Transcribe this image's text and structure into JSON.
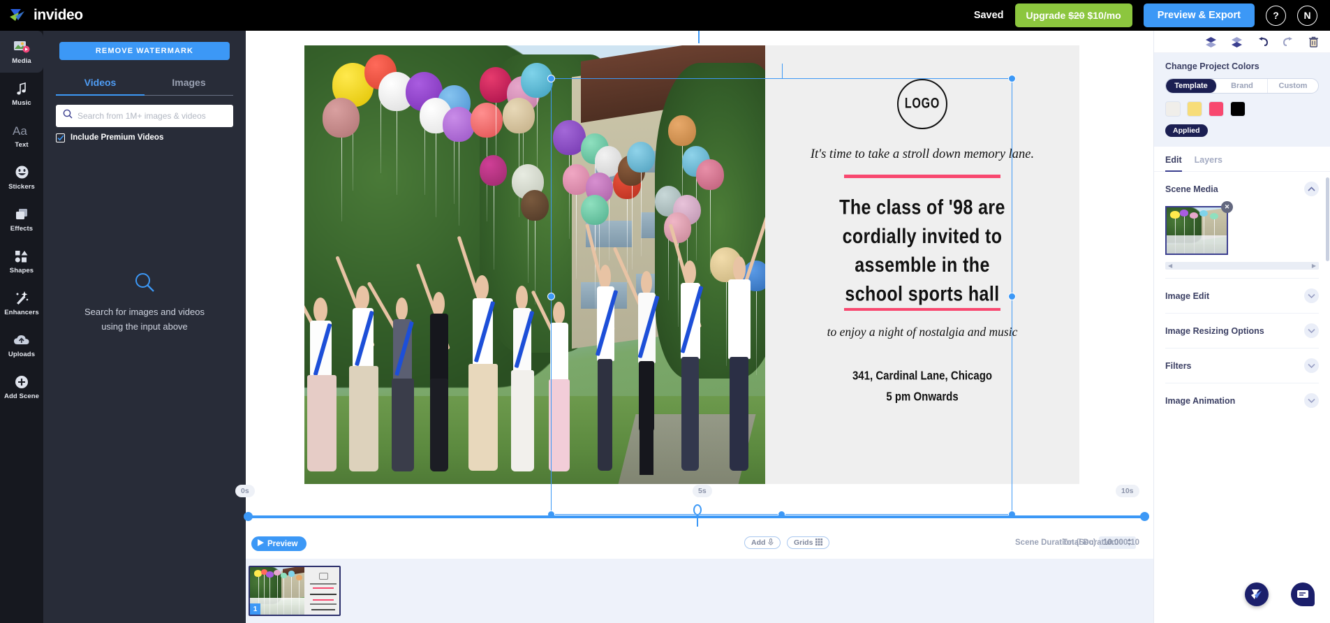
{
  "topbar": {
    "brand": "invideo",
    "saved_label": "Saved",
    "upgrade_old_price": "$20",
    "upgrade_new_price": "$10/mo",
    "upgrade_prefix": "Upgrade",
    "preview_export_label": "Preview & Export",
    "help_label": "?",
    "avatar_label": "N"
  },
  "rail": {
    "items": [
      {
        "label": "Media",
        "icon": "media-icon"
      },
      {
        "label": "Music",
        "icon": "music-note-icon"
      },
      {
        "label": "Text",
        "icon": "text-aa-icon"
      },
      {
        "label": "Stickers",
        "icon": "smiley-icon"
      },
      {
        "label": "Effects",
        "icon": "layers-squares-icon"
      },
      {
        "label": "Shapes",
        "icon": "shapes-icon"
      },
      {
        "label": "Enhancers",
        "icon": "magic-wand-icon"
      },
      {
        "label": "Uploads",
        "icon": "cloud-upload-icon"
      },
      {
        "label": "Add Scene",
        "icon": "plus-circle-icon"
      }
    ],
    "active_index": 0
  },
  "media_panel": {
    "remove_watermark_label": "REMOVE WATERMARK",
    "tabs": [
      {
        "label": "Videos",
        "active": true
      },
      {
        "label": "Images",
        "active": false
      }
    ],
    "search": {
      "value": "",
      "placeholder": "Search from 1M+ images & videos",
      "icon": "search-icon"
    },
    "premium_checkbox": {
      "label": "Include Premium Videos",
      "checked": true
    },
    "empty_state": {
      "icon": "search-large-icon",
      "line1": "Search for images and videos",
      "line2": "using the input above"
    }
  },
  "canvas": {
    "logo_text": "LOGO",
    "tagline": "It's time to take a stroll down memory lane.",
    "headline_lines": [
      "The class of '98 are",
      "cordially invited to",
      "assemble in the",
      "school sports hall"
    ],
    "subline": "to enjoy a night of nostalgia and music",
    "address_line1": "341, Cardinal Lane, Chicago",
    "address_line2": "5 pm Onwards",
    "accent_color": "#F8486F",
    "background_color": "#efefef"
  },
  "timeline": {
    "marker_start": "0s",
    "marker_mid": "5s",
    "marker_end": "10s",
    "preview_label": "Preview",
    "preview_icon": "play-icon",
    "add_label": "Add",
    "add_icon": "microphone-icon",
    "grids_label": "Grids",
    "grids_icon": "grid-icon",
    "scene_duration_label": "Scene Duration (Sec)",
    "scene_duration_value": "10.00",
    "scene_duration_stepper_icon": "up-down-arrows-icon",
    "total_duration_label": "Total Duration:00:10",
    "scene_number": "1"
  },
  "right_panel": {
    "toolbar_icons": [
      "bring-forward-icon",
      "send-backward-icon",
      "undo-icon",
      "redo-icon",
      "trash-icon"
    ],
    "colors_title": "Change Project Colors",
    "segments": [
      {
        "label": "Template",
        "active": true
      },
      {
        "label": "Brand",
        "active": false
      },
      {
        "label": "Custom",
        "active": false
      }
    ],
    "swatches": [
      "#f0eeea",
      "#f7dd79",
      "#f8486f",
      "#000000"
    ],
    "applied_label": "Applied",
    "tabs": [
      {
        "label": "Edit",
        "active": true
      },
      {
        "label": "Layers",
        "active": false
      }
    ],
    "sections": [
      {
        "title": "Scene Media",
        "expanded": true,
        "chevron": "chevron-up-icon"
      },
      {
        "title": "Image Edit",
        "expanded": false,
        "chevron": "chevron-down-icon"
      },
      {
        "title": "Image Resizing Options",
        "expanded": false,
        "chevron": "chevron-down-icon"
      },
      {
        "title": "Filters",
        "expanded": false,
        "chevron": "chevron-down-icon"
      },
      {
        "title": "Image Animation",
        "expanded": false,
        "chevron": "chevron-down-icon"
      }
    ],
    "thumb_remove_icon": "close-x-icon",
    "scroll_left_icon": "arrow-left-icon",
    "scroll_right_icon": "arrow-right-icon"
  },
  "fabs": {
    "play_icon": "invideo-play-icon",
    "chat_icon": "chat-bubble-icon"
  }
}
